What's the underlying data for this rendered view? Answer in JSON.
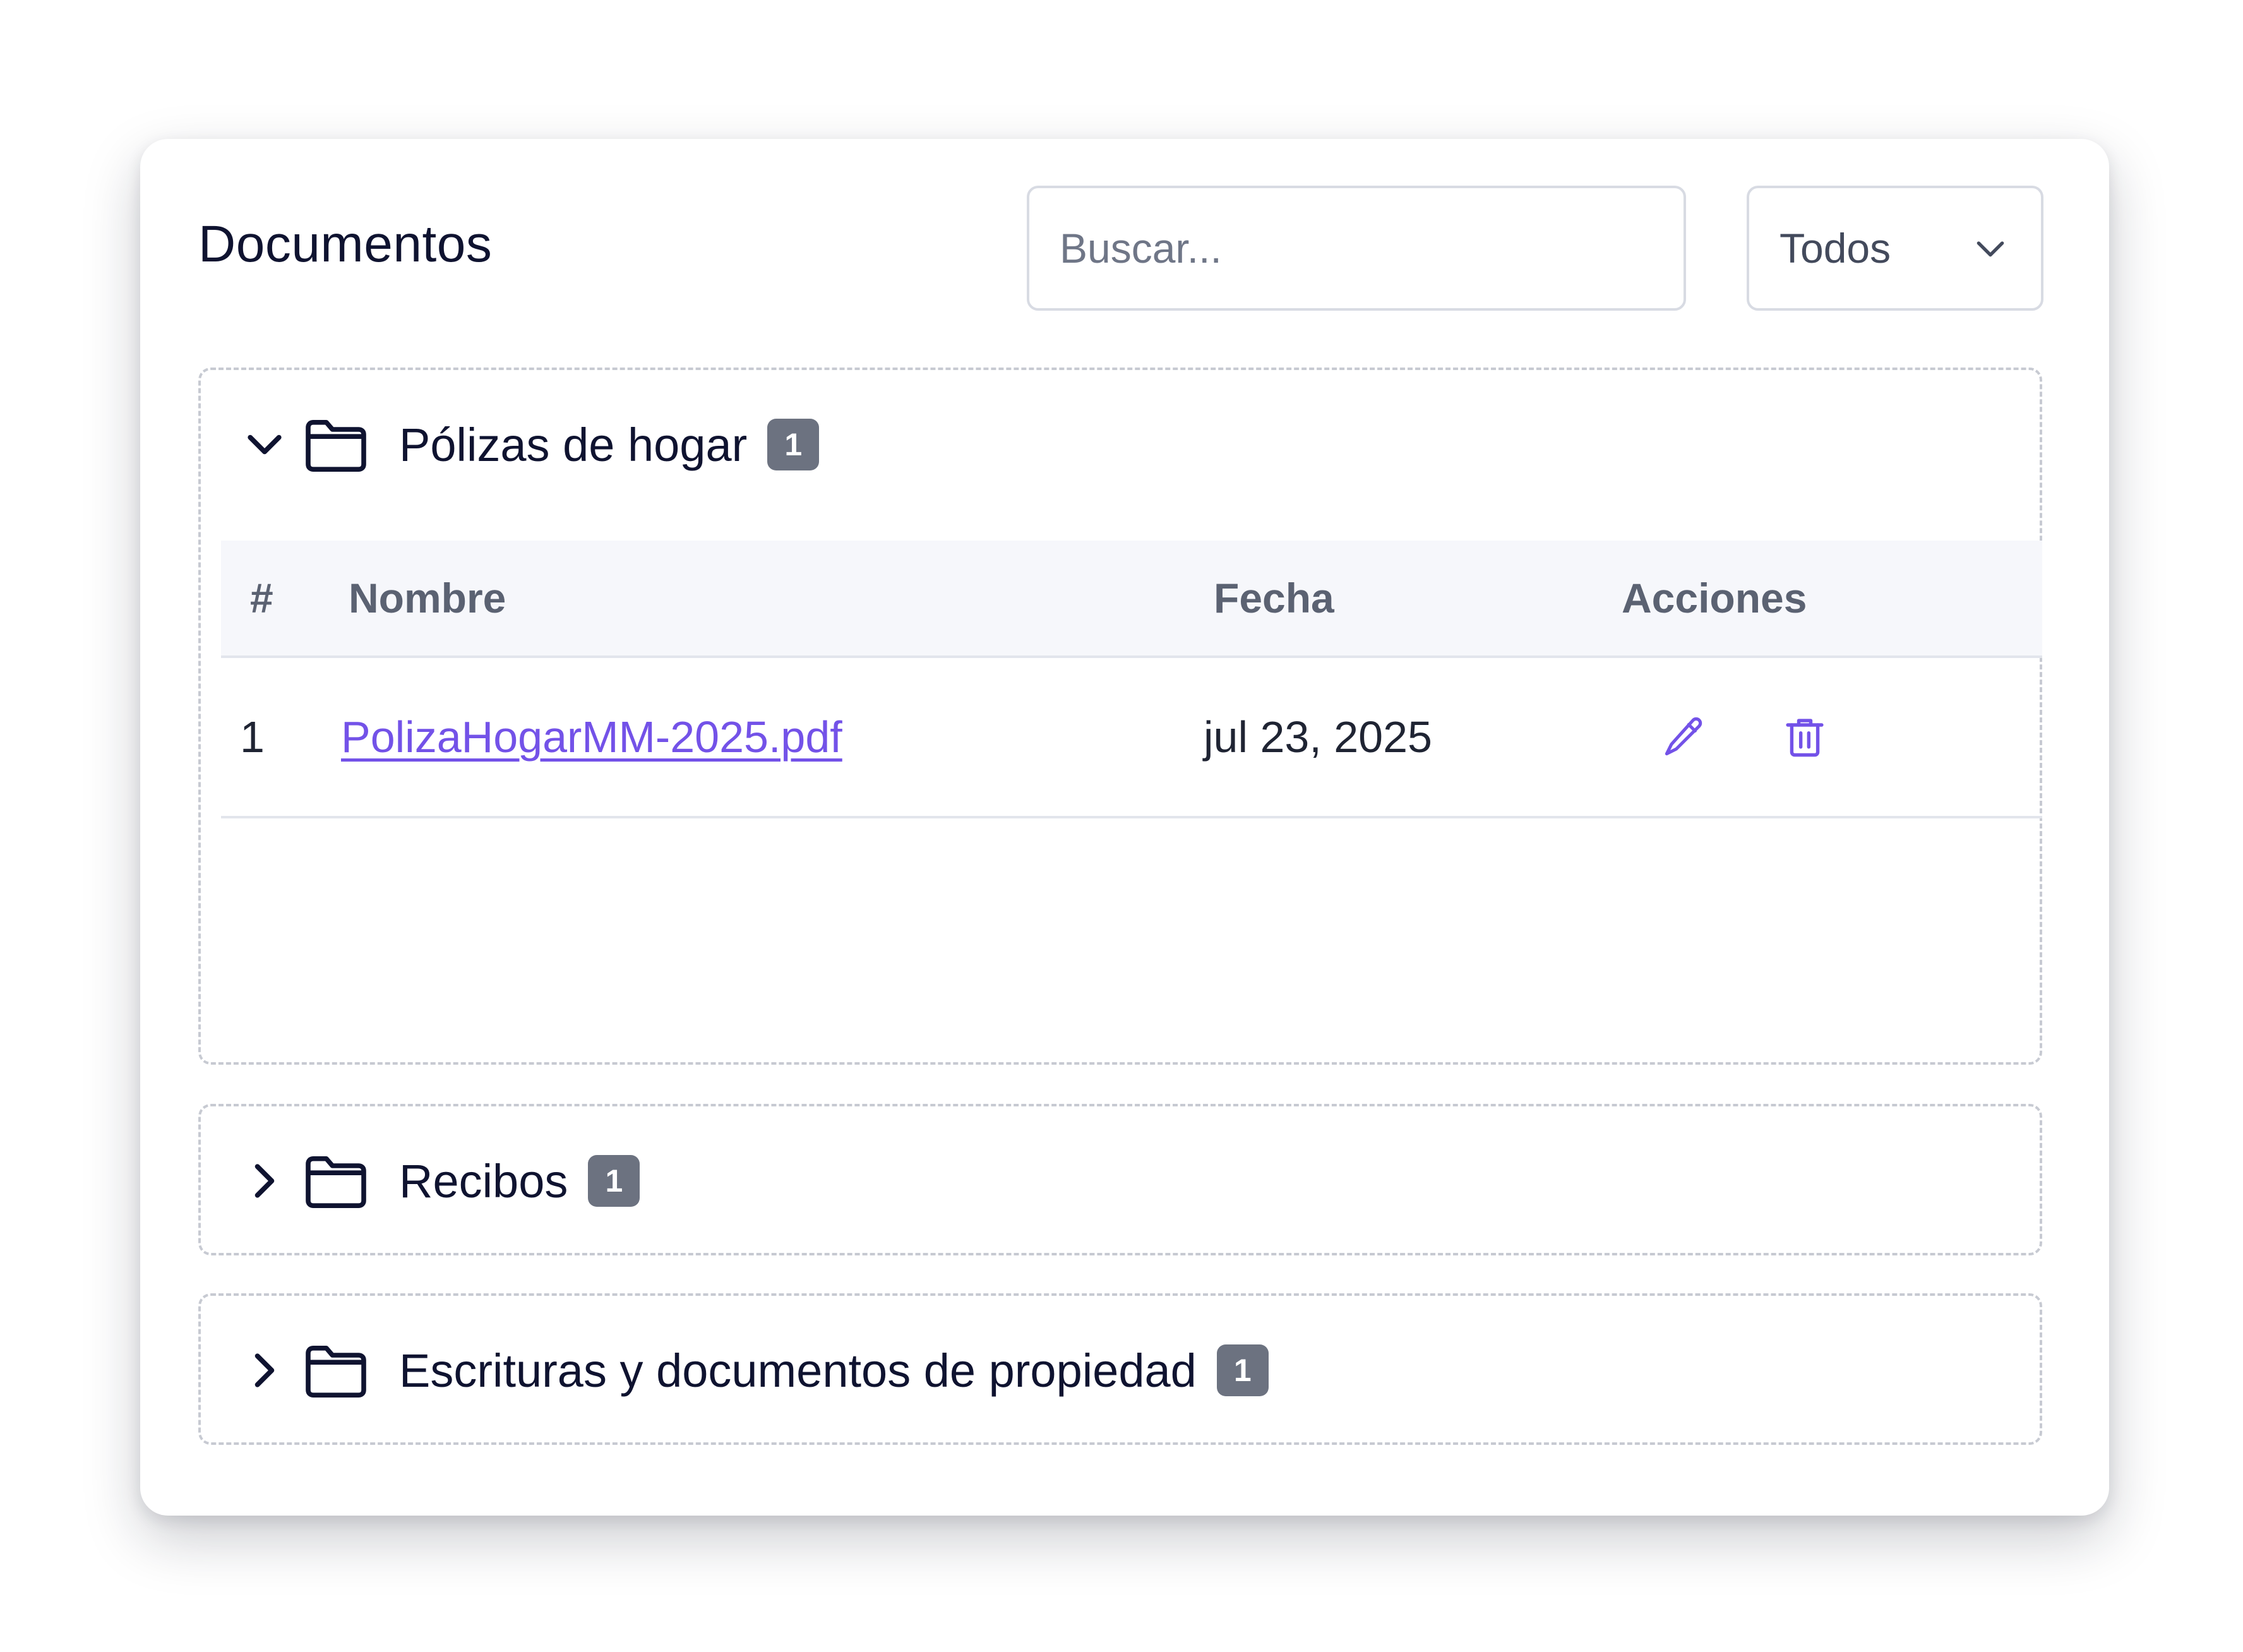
{
  "header": {
    "title": "Documentos",
    "search_placeholder": "Buscar...",
    "search_value": "",
    "filter_selected": "Todos"
  },
  "folders": [
    {
      "name": "Pólizas de hogar",
      "count": "1",
      "expanded": true,
      "table": {
        "columns": [
          "#",
          "Nombre",
          "Fecha",
          "Acciones"
        ],
        "rows": [
          {
            "index": "1",
            "name": "PolizaHogarMM-2025.pdf",
            "date": "jul 23, 2025"
          }
        ]
      }
    },
    {
      "name": "Recibos",
      "count": "1",
      "expanded": false
    },
    {
      "name": "Escrituras y documentos de propiedad",
      "count": "1",
      "expanded": false
    }
  ],
  "icons": {
    "chevron_expanded": "chevron-down-icon",
    "chevron_collapsed": "chevron-right-icon",
    "folder": "folder-icon",
    "edit": "pencil-icon",
    "delete": "trash-icon",
    "select": "chevron-down-icon"
  },
  "colors": {
    "accent": "#7352e8",
    "badge_bg": "#6c7280",
    "table_header_bg": "#f6f7fb",
    "text_dark": "#0f1330",
    "border": "#d8dbe3"
  }
}
